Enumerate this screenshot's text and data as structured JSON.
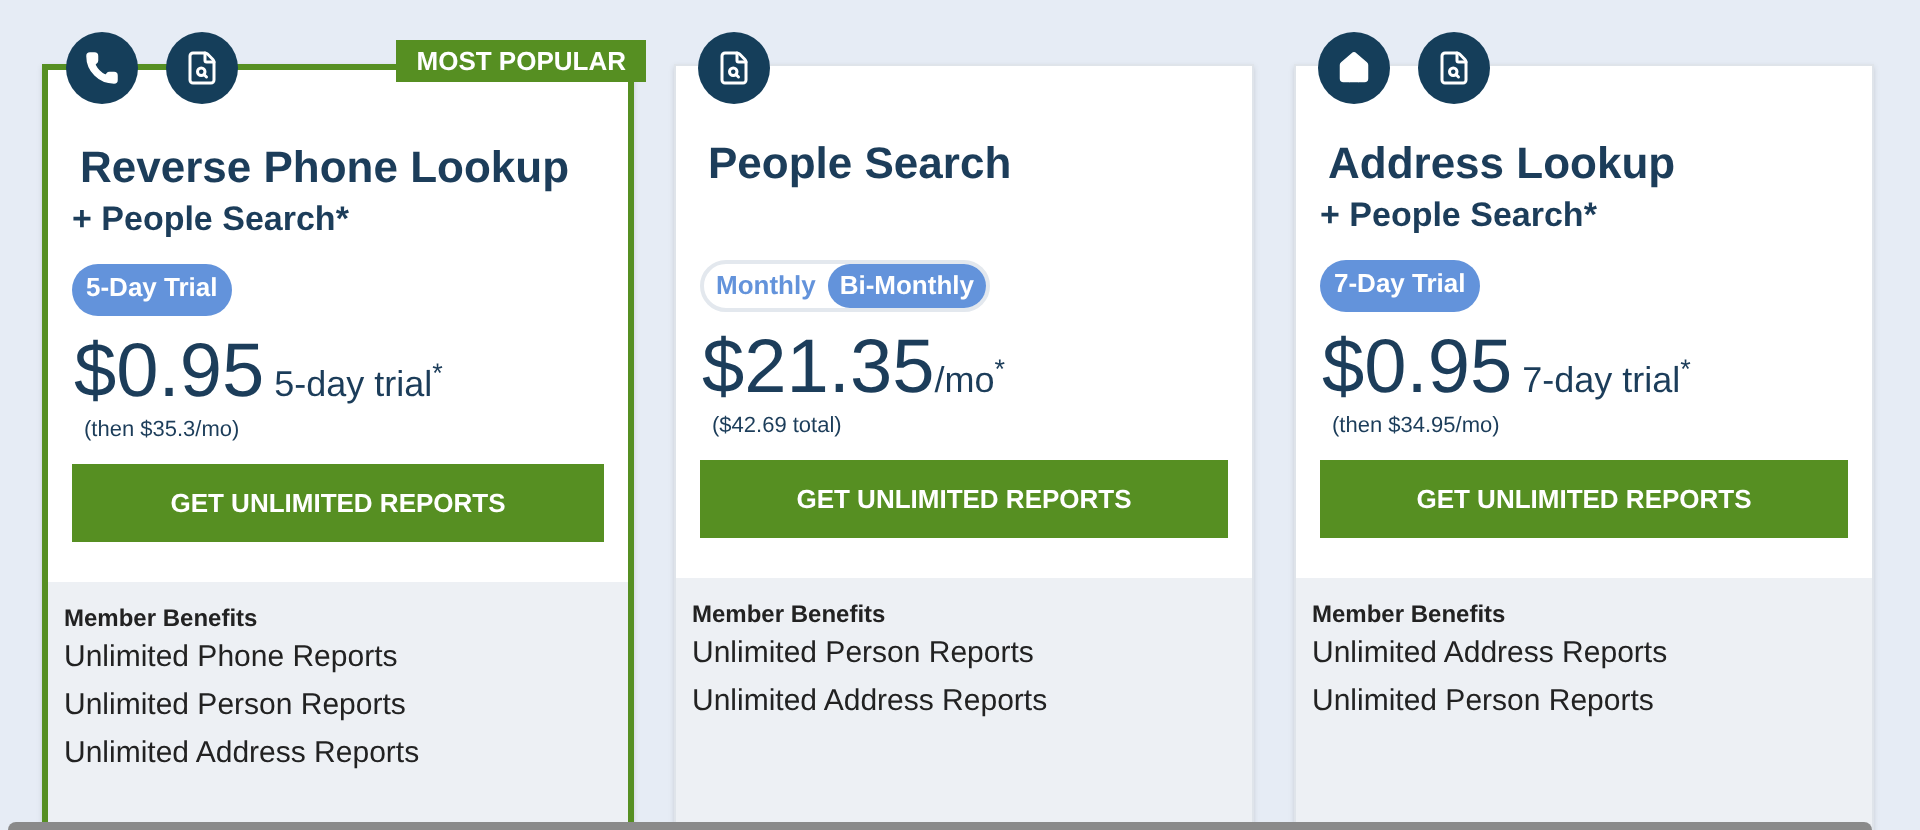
{
  "plans": [
    {
      "highlighted": true,
      "ribbon": "MOST POPULAR",
      "icons": [
        {
          "kind": "phone"
        },
        {
          "kind": "search"
        }
      ],
      "title": "Reverse Phone Lookup",
      "subtitle": "+ People Search*",
      "trial_badge": "5-Day Trial",
      "price": "$0.95",
      "price_suffix": " 5-day trial$^{*}$",
      "price_note": "(then $35.3/mo)",
      "button": "GET UNLIMITED REPORTS",
      "benefits_title": "Member Benefits",
      "benefits": [
        "Unlimited Phone Reports",
        "Unlimited Person Reports",
        "Unlimited Address Reports"
      ]
    },
    {
      "highlighted": false,
      "icons": [
        {
          "kind": "search"
        }
      ],
      "title": "People Search",
      "billing_options": [
        {
          "label": "Monthly",
          "selected": false
        },
        {
          "label": "Bi-Monthly",
          "selected": true
        }
      ],
      "price": "$21.35",
      "price_suffix": "/mo$^{*}$",
      "price_note": "($42.69 total)",
      "button": "GET UNLIMITED REPORTS",
      "benefits_title": "Member Benefits",
      "benefits": [
        "Unlimited Person Reports",
        "Unlimited Address Reports"
      ]
    },
    {
      "highlighted": false,
      "icons": [
        {
          "kind": "home"
        },
        {
          "kind": "search"
        }
      ],
      "title": "Address Lookup",
      "subtitle": "+ People Search*",
      "trial_badge": "7-Day Trial",
      "price": "$0.95",
      "price_suffix": " 7-day trial$^{*}$",
      "price_note": "(then $34.95/mo)",
      "button": "GET UNLIMITED REPORTS",
      "benefits_title": "Member Benefits",
      "benefits": [
        "Unlimited Address Reports",
        "Unlimited Person Reports"
      ]
    }
  ]
}
